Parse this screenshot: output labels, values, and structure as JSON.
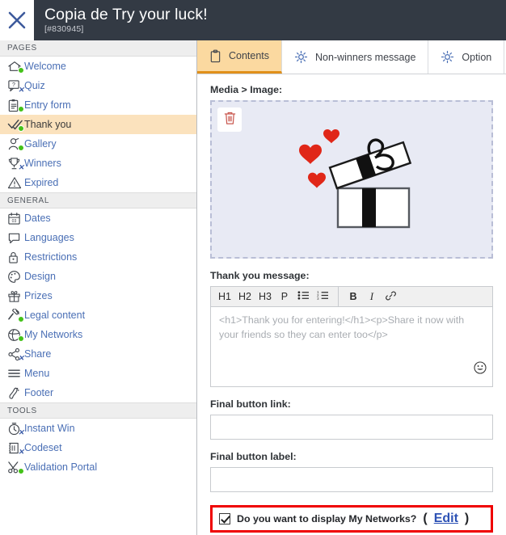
{
  "topbar": {
    "close_icon": "close-x-icon",
    "title": "Copia de Try your luck!",
    "subtitle": "[#830945]"
  },
  "sidebar": {
    "sections": [
      {
        "heading": "PAGES",
        "items": [
          {
            "label": "Welcome",
            "icon": "home-icon",
            "status": "active"
          },
          {
            "label": "Quiz",
            "icon": "question-bubble-icon",
            "status": "disabled"
          },
          {
            "label": "Entry form",
            "icon": "clipboard-form-icon",
            "status": "active"
          },
          {
            "label": "Thank you",
            "icon": "double-check-icon",
            "status": "active",
            "selected": true
          },
          {
            "label": "Gallery",
            "icon": "gallery-icon",
            "status": "active"
          },
          {
            "label": "Winners",
            "icon": "trophy-icon",
            "status": "disabled"
          },
          {
            "label": "Expired",
            "icon": "warning-triangle-icon",
            "status": "none"
          }
        ]
      },
      {
        "heading": "GENERAL",
        "items": [
          {
            "label": "Dates",
            "icon": "calendar-icon",
            "status": "none"
          },
          {
            "label": "Languages",
            "icon": "speech-bubble-icon",
            "status": "none"
          },
          {
            "label": "Restrictions",
            "icon": "lock-icon",
            "status": "none"
          },
          {
            "label": "Design",
            "icon": "palette-icon",
            "status": "none"
          },
          {
            "label": "Prizes",
            "icon": "gift-icon",
            "status": "none"
          },
          {
            "label": "Legal content",
            "icon": "gavel-icon",
            "status": "active"
          },
          {
            "label": "My Networks",
            "icon": "network-globe-icon",
            "status": "active"
          },
          {
            "label": "Share",
            "icon": "share-nodes-icon",
            "status": "disabled"
          },
          {
            "label": "Menu",
            "icon": "hamburger-menu-icon",
            "status": "none"
          },
          {
            "label": "Footer",
            "icon": "footprint-icon",
            "status": "none"
          }
        ]
      },
      {
        "heading": "TOOLS",
        "items": [
          {
            "label": "Instant Win",
            "icon": "stopwatch-icon",
            "status": "disabled"
          },
          {
            "label": "Codeset",
            "icon": "ticket-icon",
            "status": "disabled"
          },
          {
            "label": "Validation Portal",
            "icon": "scissors-icon",
            "status": "active"
          }
        ]
      }
    ]
  },
  "tabs": [
    {
      "label": "Contents",
      "icon": "clipboard-icon",
      "active": true
    },
    {
      "label": "Non-winners message",
      "icon": "gear-icon",
      "active": false
    },
    {
      "label": "Option",
      "icon": "gear-icon",
      "active": false
    }
  ],
  "main": {
    "media_label": "Media > Image:",
    "trash_icon": "trash-icon",
    "preview_image": "open-gift-box-with-hearts",
    "message_label": "Thank you message:",
    "editor": {
      "toolbar": [
        {
          "label": "H1",
          "name": "heading-1-button"
        },
        {
          "label": "H2",
          "name": "heading-2-button"
        },
        {
          "label": "H3",
          "name": "heading-3-button"
        },
        {
          "label": "P",
          "name": "paragraph-button"
        },
        {
          "label": "bullet-list-icon",
          "name": "bullet-list-button"
        },
        {
          "label": "numbered-list-icon",
          "name": "numbered-list-button"
        },
        {
          "label": "B",
          "name": "bold-button"
        },
        {
          "label": "I",
          "name": "italic-button"
        },
        {
          "label": "link-icon",
          "name": "link-button"
        }
      ],
      "placeholder": "<h1>Thank you for entering!</h1><p>Share it now with your friends so they can enter too</p>",
      "value": "",
      "emoji_icon": "smiley-emoji-icon"
    },
    "final_button_link_label": "Final button link:",
    "final_button_link_value": "",
    "final_button_label_label": "Final button label:",
    "final_button_label_value": "",
    "networks_checkbox": {
      "checked": true,
      "label": "Do you want to display My Networks?",
      "open_paren": "(",
      "edit_link": "Edit",
      "close_paren": ")"
    }
  },
  "colors": {
    "topbar_bg": "#333a44",
    "active_tab_bg": "#fbd9a0",
    "active_tab_underline": "#e0901a",
    "selected_nav_bg": "#fbe2bd",
    "nav_link": "#4a6fb5",
    "status_active": "#44c219",
    "status_disabled": "#3b5ca8",
    "highlight_border": "#ef0000",
    "dropzone_bg": "#e8eaf4",
    "link_blue": "#2d52b5"
  }
}
